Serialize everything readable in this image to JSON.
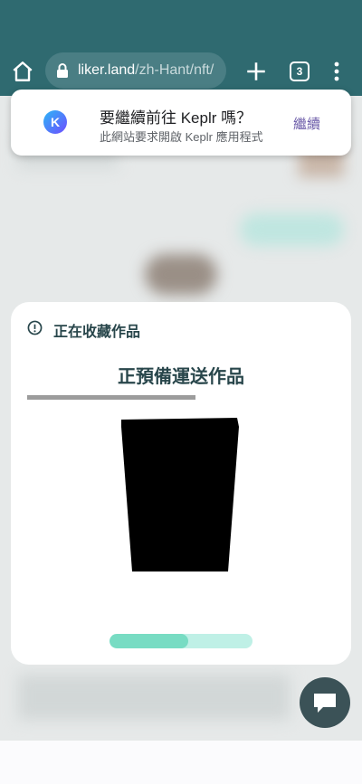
{
  "browser": {
    "url_host": "liker.land",
    "url_path": "/zh-Hant/nft/",
    "tab_count": "3"
  },
  "prompt": {
    "app_icon_letter": "K",
    "title": "要繼續前往 Keplr 嗎？",
    "subtitle": "此網站要求開啟 Keplr 應用程式",
    "continue_label": "繼續"
  },
  "dialog": {
    "header": "正在收藏作品",
    "title": "正預備運送作品",
    "loading_progress": 0.55
  },
  "colors": {
    "toolbar": "#2f6a70",
    "dialog_text": "#28464b",
    "loading_fill": "#78dcc3",
    "loading_track": "#bff0e6",
    "continue_text": "#6b5ba8"
  },
  "icons": [
    "home-icon",
    "lock-icon",
    "plus-icon",
    "tabs-icon",
    "more-vert-icon",
    "info-icon",
    "chat-icon"
  ]
}
